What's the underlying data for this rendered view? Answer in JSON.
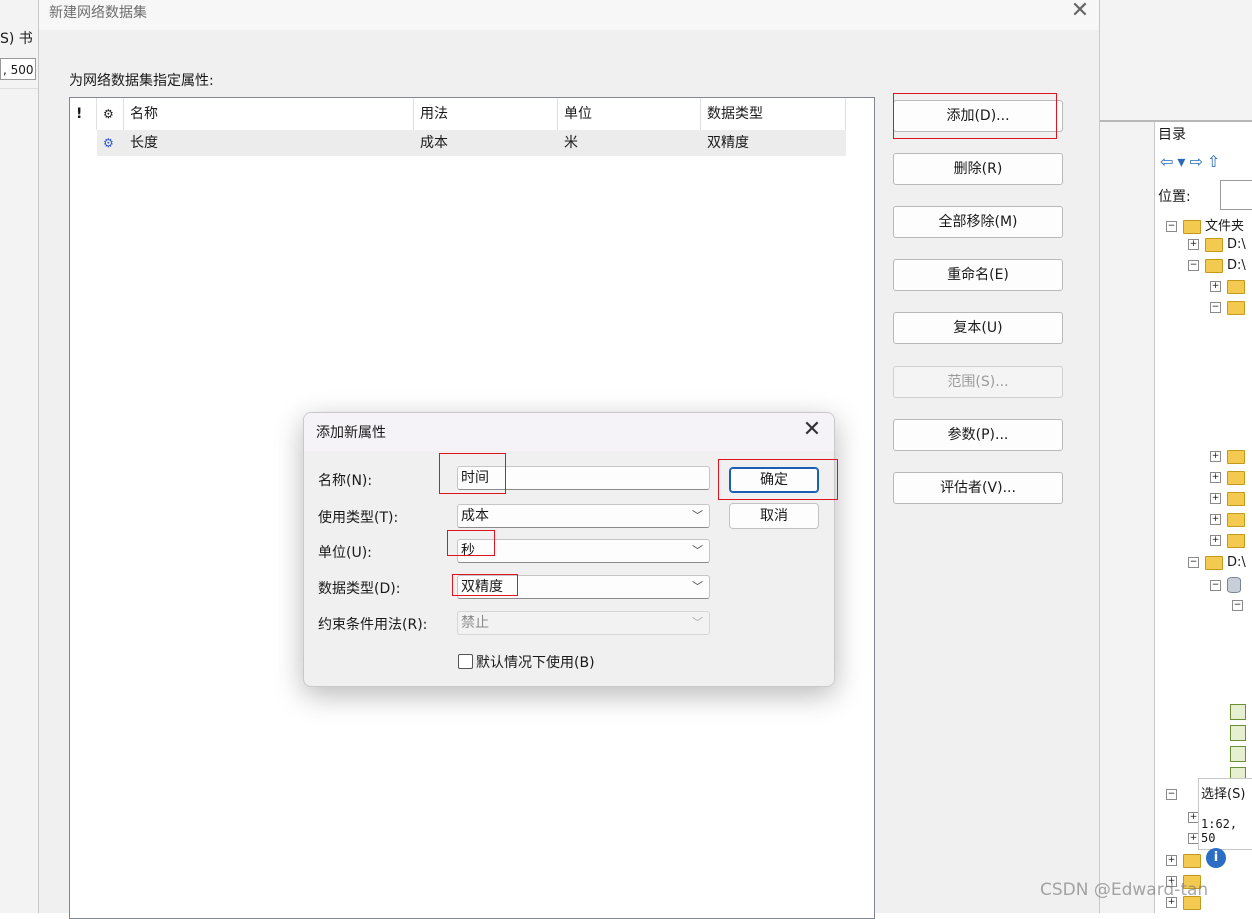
{
  "background_left": {
    "menu_fragment": "S)  书",
    "scale_fragment": ", 500"
  },
  "main_dialog": {
    "title": "新建网络数据集",
    "prompt": "为网络数据集指定属性:",
    "table": {
      "headers": [
        "!",
        "⚙",
        "名称",
        "用法",
        "单位",
        "数据类型"
      ],
      "rows": [
        {
          "name": "长度",
          "usage": "成本",
          "unit": "米",
          "type": "双精度"
        }
      ]
    },
    "buttons": {
      "add": "添加(D)...",
      "delete": "删除(R)",
      "remove_all": "全部移除(M)",
      "rename": "重命名(E)",
      "duplicate": "复本(U)",
      "range": "范围(S)...",
      "parameters": "参数(P)...",
      "evaluators": "评估者(V)..."
    }
  },
  "add_dialog": {
    "title": "添加新属性",
    "labels": {
      "name": "名称(N):",
      "usage_type": "使用类型(T):",
      "units": "单位(U):",
      "data_type": "数据类型(D):",
      "restriction_usage": "约束条件用法(R):"
    },
    "values": {
      "name": "时间",
      "usage_type": "成本",
      "units": "秒",
      "data_type": "双精度",
      "restriction_usage": "禁止"
    },
    "ok": "确定",
    "cancel": "取消",
    "default_checkbox": "默认情况下使用(B)"
  },
  "catalog": {
    "title": "目录",
    "location_label": "位置:",
    "tree": [
      "文件夹",
      "D:\\",
      "D:\\",
      "D:\\"
    ],
    "popup_select": "选择(S)",
    "popup_scale": "1:62, 50"
  },
  "watermark": "CSDN @Edward-tan",
  "colors": {
    "highlight": "#e0141e",
    "primary_border": "#1a5fb4"
  }
}
